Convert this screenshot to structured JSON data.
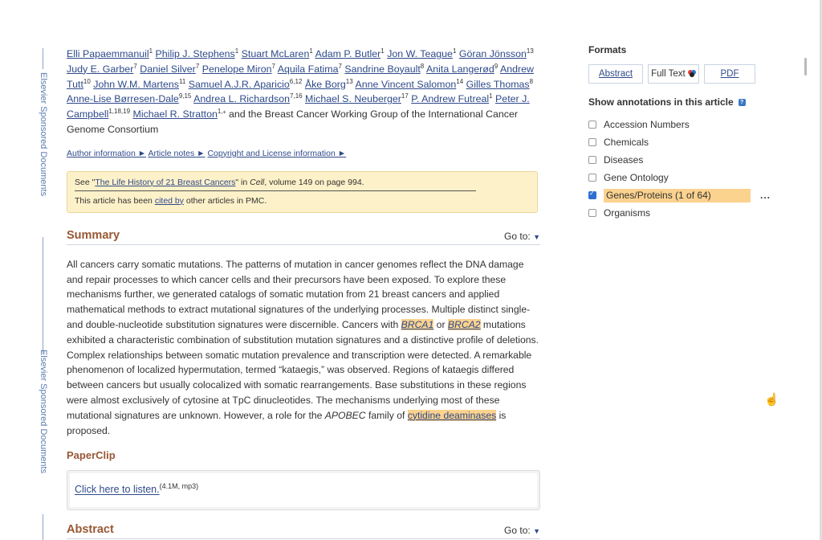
{
  "sidebar": {
    "label": "Elsevier Sponsored Documents"
  },
  "authors": [
    {
      "name": "Elli Papaemmanuil",
      "sup": "1"
    },
    {
      "name": "Philip J. Stephens",
      "sup": "1"
    },
    {
      "name": "Stuart McLaren",
      "sup": "1"
    },
    {
      "name": "Adam P. Butler",
      "sup": "1"
    },
    {
      "name": "Jon W. Teague",
      "sup": "1"
    },
    {
      "name": "Göran Jönsson",
      "sup": "13"
    },
    {
      "name": "Judy E. Garber",
      "sup": "7"
    },
    {
      "name": "Daniel Silver",
      "sup": "7"
    },
    {
      "name": "Penelope Miron",
      "sup": "7"
    },
    {
      "name": "Aquila Fatima",
      "sup": "7"
    },
    {
      "name": "Sandrine Boyault",
      "sup": "8"
    },
    {
      "name": "Anita Langerød",
      "sup": "9"
    },
    {
      "name": "Andrew Tutt",
      "sup": "10"
    },
    {
      "name": "John W.M. Martens",
      "sup": "11"
    },
    {
      "name": "Samuel A.J.R. Aparicio",
      "sup": "6,12"
    },
    {
      "name": "Åke Borg",
      "sup": "13"
    },
    {
      "name": "Anne Vincent Salomon",
      "sup": "14"
    },
    {
      "name": "Gilles Thomas",
      "sup": "8"
    },
    {
      "name": "Anne-Lise Børresen-Dale",
      "sup": "9,15"
    },
    {
      "name": "Andrea L. Richardson",
      "sup": "7,16"
    },
    {
      "name": "Michael S. Neuberger",
      "sup": "17"
    },
    {
      "name": "P. Andrew Futreal",
      "sup": "1"
    },
    {
      "name": "Peter J. Campbell",
      "sup": "1,18,19"
    },
    {
      "name": "Michael R. Stratton",
      "sup": "1,⁎"
    }
  ],
  "authors_suffix": "and the Breast Cancer Working Group of the International Cancer Genome Consortium",
  "meta_links": [
    "Author information ►",
    "Article notes ►",
    "Copyright and License information ►"
  ],
  "notice": {
    "see_prefix": "See \"",
    "see_link": "The Life History of 21 Breast Cancers",
    "see_mid": "\" in ",
    "see_journal": "Cell",
    "see_suffix": ", volume 149 on page 994.",
    "cited_prefix": "This article has been ",
    "cited_link": "cited by",
    "cited_suffix": " other articles in PMC."
  },
  "goto_label": "Go to:",
  "goto_arrow": "▼",
  "summary": {
    "title": "Summary",
    "part1": "All cancers carry somatic mutations. The patterns of mutation in cancer genomes reflect the DNA damage and repair processes to which cancer cells and their precursors have been exposed. To explore these mechanisms further, we generated catalogs of somatic mutation from 21 breast cancers and applied mathematical methods to extract mutational signatures of the underlying processes. Multiple distinct single- and double-nucleotide substitution signatures were discernible. Cancers with ",
    "gene1": "BRCA1",
    "or": " or ",
    "gene2": "BRCA2",
    "part2": " mutations exhibited a characteristic combination of substitution mutation signatures and a distinctive profile of deletions. Complex relationships between somatic mutation prevalence and transcription were detected. A remarkable phenomenon of localized hypermutation, termed “kataegis,” was observed. Regions of kataegis differed between cancers but usually colocalized with somatic rearrangements. Base substitutions in these regions were almost exclusively of cytosine at TpC dinucleotides. The mechanisms underlying most of these mutational signatures are unknown. However, a role for the ",
    "apobec": "APOBEC",
    "part3": " family of ",
    "gene3": "cytidine deaminases",
    "part4": " is proposed."
  },
  "paperclip": {
    "title": "PaperClip",
    "link": "Click here to listen.",
    "meta": "(4.1M, mp3)"
  },
  "abstract": {
    "title": "Abstract"
  },
  "formats": {
    "title": "Formats",
    "abstract": "Abstract",
    "fulltext": "Full Text",
    "pdf": "PDF"
  },
  "annotations": {
    "title": "Show annotations in this article",
    "help": "?",
    "items": [
      {
        "label": "Accession Numbers",
        "checked": false
      },
      {
        "label": "Chemicals",
        "checked": false
      },
      {
        "label": "Diseases",
        "checked": false
      },
      {
        "label": "Gene Ontology",
        "checked": false
      },
      {
        "label": "Genes/Proteins (1 of 64)",
        "checked": true
      },
      {
        "label": "Organisms",
        "checked": false
      }
    ],
    "more": "..."
  },
  "colors": {
    "link": "#2f4a8a",
    "heading": "#985735",
    "highlight": "#fbd28e",
    "notice_bg": "#fdf1c9"
  },
  "icons": {
    "cursor": "hand-pointer-icon",
    "fulltext_badge": "multicolor-badge-icon"
  }
}
